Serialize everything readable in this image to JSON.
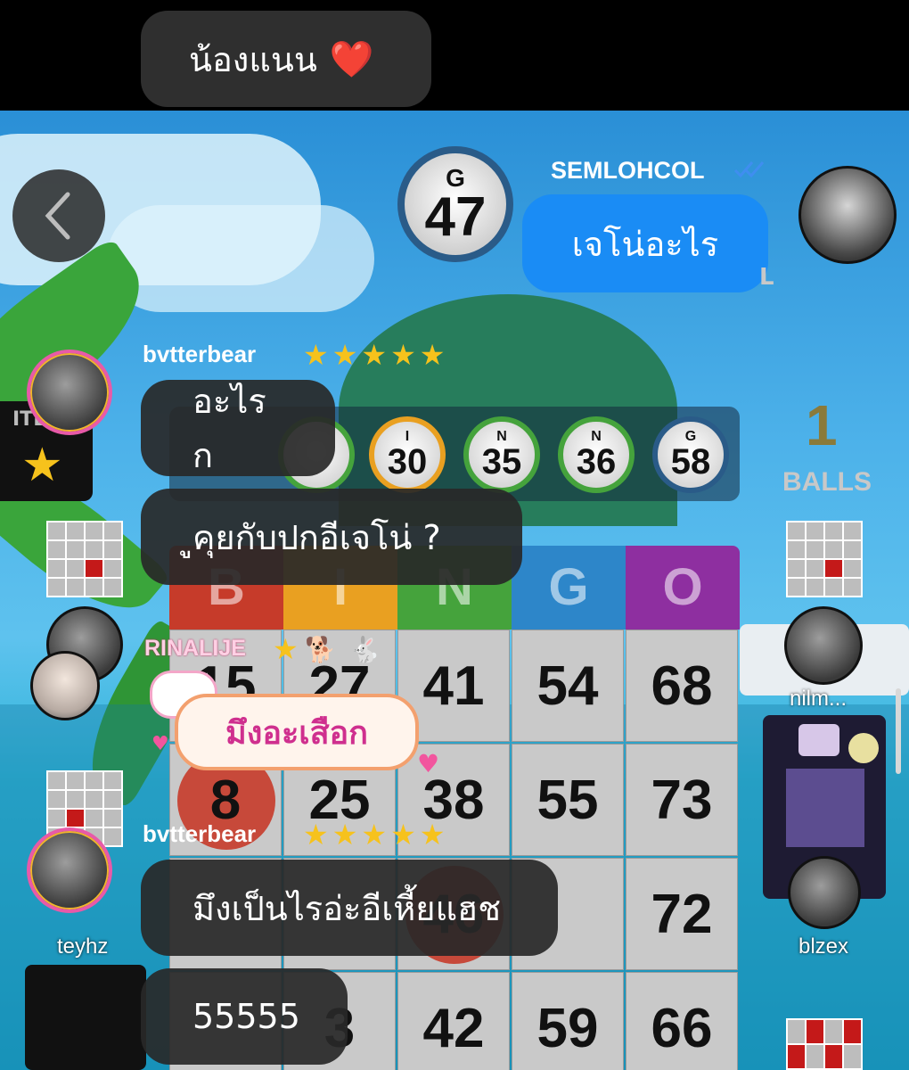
{
  "header": {
    "message": "น้องแนน",
    "icon": "heart-icon",
    "icon_glyph": "❤️"
  },
  "game": {
    "current_ball": {
      "letter": "G",
      "number": "47"
    },
    "called_balls": [
      {
        "letter": "I",
        "number": "30"
      },
      {
        "letter": "N",
        "number": "35"
      },
      {
        "letter": "N",
        "number": "36"
      },
      {
        "letter": "G",
        "number": "58"
      }
    ],
    "balls_left": {
      "count": "1",
      "label": "BALLS"
    },
    "card_header": [
      "B",
      "I",
      "N",
      "G",
      "O"
    ],
    "card_rows": [
      [
        "15",
        "27",
        "41",
        "54",
        "68"
      ],
      [
        "8",
        "25",
        "38",
        "55",
        "73"
      ],
      [
        "",
        "",
        "46",
        "",
        "72"
      ],
      [
        "",
        "3",
        "42",
        "59",
        "66"
      ]
    ],
    "players": [
      "nilm...",
      "blzex",
      "teyhz"
    ],
    "side_label": "ITE"
  },
  "chat": {
    "outgoing": {
      "sender": "SEMLOHCOL",
      "text": "เจโน่อะไร",
      "read_icon": "double-check-icon"
    },
    "messages": [
      {
        "sender": "bvtterbear",
        "text": "อะไรก"
      },
      {
        "sender": "bvtterbear",
        "text": "ูคุยกับปกอีเจโน่ ?"
      },
      {
        "sender": "RINALIJE",
        "text": "มึงอะเสือก"
      },
      {
        "sender": "bvtterbear",
        "text": "มึงเป็นไรอ่ะอีเหี้ยแฮช"
      },
      {
        "sender": "bvtterbear",
        "text": "55555"
      }
    ]
  },
  "colors": {
    "blue_bubble": "#1a8cf5",
    "b": "#c63b2a",
    "i": "#e9a021",
    "n": "#45a33c",
    "g": "#2d86c9",
    "o": "#8e2fa0"
  }
}
